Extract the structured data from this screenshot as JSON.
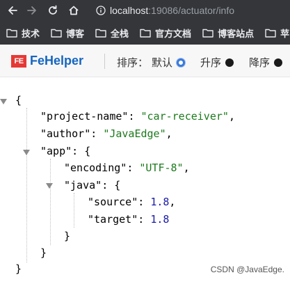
{
  "browser": {
    "url_host": "localhost",
    "url_rest": ":19086/actuator/info"
  },
  "bookmarks": [
    {
      "label": "技术"
    },
    {
      "label": "博客"
    },
    {
      "label": "全栈"
    },
    {
      "label": "官方文档"
    },
    {
      "label": "博客站点"
    },
    {
      "label": "苹"
    }
  ],
  "fehelper": {
    "logo_text": "FE",
    "title": "FeHelper",
    "sort_label": "排序：",
    "options": [
      {
        "label": "默认",
        "selected": true
      },
      {
        "label": "升序",
        "selected": false
      },
      {
        "label": "降序",
        "selected": false
      }
    ]
  },
  "json": {
    "open_brace": "{",
    "close_brace": "}",
    "project_name_key": "\"project-name\"",
    "project_name_value": "\"car-receiver\"",
    "author_key": "\"author\"",
    "author_value": "\"JavaEdge\"",
    "app_key": "\"app\"",
    "encoding_key": "\"encoding\"",
    "encoding_value": "\"UTF-8\"",
    "java_key": "\"java\"",
    "source_key": "\"source\"",
    "source_value": "1.8",
    "target_key": "\"target\"",
    "target_value": "1.8"
  },
  "watermark": "CSDN @JavaEdge."
}
